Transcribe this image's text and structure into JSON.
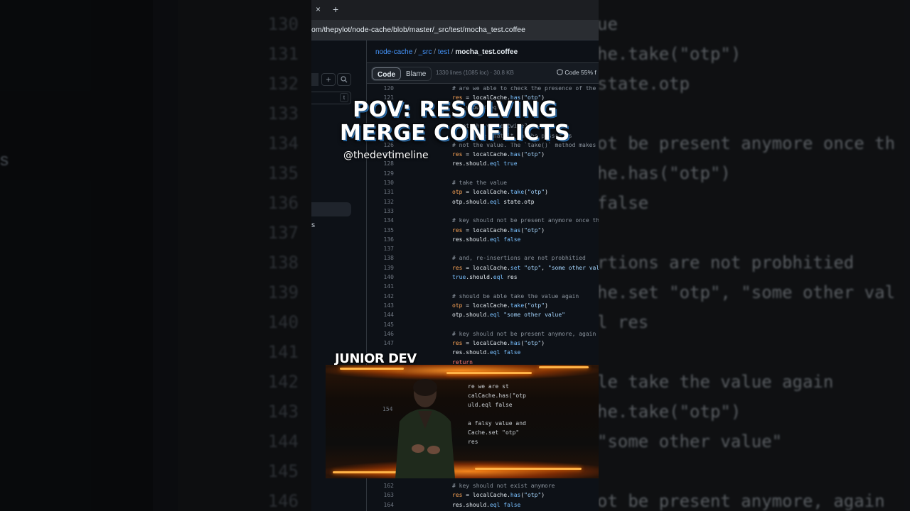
{
  "background": {
    "line_numbers": [
      "130",
      "131",
      "132",
      "133",
      "134",
      "135",
      "136",
      "137",
      "138",
      "139",
      "140",
      "141",
      "142",
      "143",
      "144",
      "145",
      "146"
    ],
    "code_fragments": [
      "ue",
      "he.take(\"otp\")",
      " state.otp",
      "",
      "ot be present anymore once th",
      "he.has(\"otp\")",
      " false",
      "",
      "rtions are not probhitied",
      "he.set \"otp\", \"some other val",
      "l res",
      "",
      "le take the value again",
      "he.take(\"otp\")",
      " \"some other value\"",
      "",
      "ot be present anymore, again"
    ],
    "left_fragment": "s"
  },
  "browser": {
    "tab_close": "×",
    "tab_new": "+",
    "url": "om/thepylot/node-cache/blob/master/_src/test/mocha_test.coffee"
  },
  "sidebar": {
    "plus": "+",
    "filter_key": "t",
    "item_fragment": "s"
  },
  "file": {
    "breadcrumb": {
      "repo": "node-cache",
      "sep1": " / ",
      "dir1": "_src",
      "sep2": " / ",
      "dir2": "test",
      "sep3": " / ",
      "file": "mocha_test.coffee"
    },
    "tabs": {
      "code": "Code",
      "blame": "Blame"
    },
    "meta": "1330 lines (1085 loc) · 30.8 KB",
    "language": "Code 55% f"
  },
  "code_lines": [
    {
      "n": "120",
      "html": "<span class='c'># are we able to check the presence of the</span>"
    },
    {
      "n": "121",
      "html": "<span class='v'>res</span> = localCache.<span class='k'>has</span>(<span class='s'>\"otp\"</span>)"
    },
    {
      "n": "",
      "html": "res.shou<span class='c'>ld.eql</span>"
    },
    {
      "n": "",
      "html": ""
    },
    {
      "n": "",
      "html": "<span class='c'># get the value twice?</span>"
    },
    {
      "n": "",
      "html": "<span class='c'># ... note that it can be passed as</span>"
    },
    {
      "n": "126",
      "html": "<span class='c'># not the value. The `take()` method makes</span>"
    },
    {
      "n": "127",
      "html": "<span class='v'>res</span> = localCache.<span class='k'>has</span>(<span class='s'>\"otp\"</span>)"
    },
    {
      "n": "128",
      "html": "res.should.<span class='k'>eql</span> <span class='k'>true</span>"
    },
    {
      "n": "129",
      "html": ""
    },
    {
      "n": "130",
      "html": "<span class='c'># take the value</span>"
    },
    {
      "n": "131",
      "html": "<span class='v'>otp</span> = localCache.<span class='k'>take</span>(<span class='s'>\"otp\"</span>)"
    },
    {
      "n": "132",
      "html": "otp.should.<span class='k'>eql</span> state.otp"
    },
    {
      "n": "133",
      "html": ""
    },
    {
      "n": "134",
      "html": "<span class='c'># key should not be present anymore once th</span>"
    },
    {
      "n": "135",
      "html": "<span class='v'>res</span> = localCache.<span class='k'>has</span>(<span class='s'>\"otp\"</span>)"
    },
    {
      "n": "136",
      "html": "res.should.<span class='k'>eql</span> <span class='k'>false</span>"
    },
    {
      "n": "137",
      "html": ""
    },
    {
      "n": "138",
      "html": "<span class='c'># and, re-insertions are not probhitied</span>"
    },
    {
      "n": "139",
      "html": "<span class='v'>res</span> = localCache.<span class='k'>set</span> <span class='s'>\"otp\"</span>, <span class='s'>\"some other val</span>"
    },
    {
      "n": "140",
      "html": "<span class='k'>true</span>.should.<span class='k'>eql</span> res"
    },
    {
      "n": "141",
      "html": ""
    },
    {
      "n": "142",
      "html": "<span class='c'># should be able take the value again</span>"
    },
    {
      "n": "143",
      "html": "<span class='v'>otp</span> = localCache.<span class='k'>take</span>(<span class='s'>\"otp\"</span>)"
    },
    {
      "n": "144",
      "html": "otp.should.<span class='k'>eql</span> <span class='s'>\"some other value\"</span>"
    },
    {
      "n": "145",
      "html": ""
    },
    {
      "n": "146",
      "html": "<span class='c'># key should not be present anymore, again</span>"
    },
    {
      "n": "147",
      "html": "<span class='v'>res</span> = localCache.<span class='k'>has</span>(<span class='s'>\"otp\"</span>)"
    },
    {
      "n": "",
      "html": "res.should.<span class='k'>eql</span> <span class='k'>false</span>"
    },
    {
      "n": "",
      "html": "<span class='r'>return</span>"
    }
  ],
  "code_lines_bottom": [
    {
      "n": "162",
      "html": "<span class='c'># key should not exist anymore</span>"
    },
    {
      "n": "163",
      "html": "<span class='v'>res</span> = localCache.<span class='k'>has</span>(<span class='s'>\"otp\"</span>)"
    },
    {
      "n": "164",
      "html": "res.should.<span class='k'>eql</span> <span class='k'>false</span>"
    }
  ],
  "clip": {
    "code": [
      "re we are st",
      "calCache.has(\"otp",
      "uld.eql false",
      "",
      "a falsy value and",
      "Cache.set \"otp\"",
      "     res"
    ],
    "line_number": "154"
  },
  "overlay": {
    "title_line1": "POV: RESOLVING",
    "title_line2": "MERGE CONFLICTS",
    "handle": "@thedevtimeline",
    "caption": "JUNIOR DEV"
  },
  "colors": {
    "accent_link": "#4493f8",
    "title_outline": "#2a6fb0",
    "fire": "#ff7a00"
  }
}
